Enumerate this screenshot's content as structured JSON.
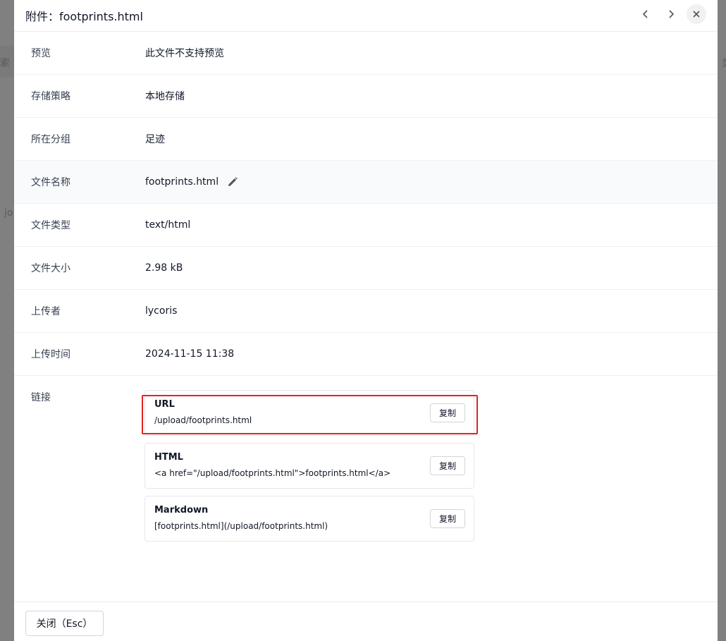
{
  "backdrop": {
    "left_glyph": "索",
    "left_glyph2": "jo",
    "right_glyph": "类"
  },
  "modal": {
    "title": "附件：footprints.html",
    "prev_label": "‹",
    "next_label": "›",
    "close_label": "✕"
  },
  "details": [
    {
      "label": "预览",
      "value": "此文件不支持预览"
    },
    {
      "label": "存储策略",
      "value": "本地存储"
    },
    {
      "label": "所在分组",
      "value": "足迹"
    },
    {
      "label": "文件名称",
      "value": "footprints.html"
    },
    {
      "label": "文件类型",
      "value": "text/html"
    },
    {
      "label": "文件大小",
      "value": "2.98 kB"
    },
    {
      "label": "上传者",
      "value": "lycoris"
    },
    {
      "label": "上传时间",
      "value": "2024-11-15 11:38"
    }
  ],
  "links": {
    "label": "链接",
    "items": [
      {
        "title": "URL",
        "value": "/upload/footprints.html",
        "copy": "复制"
      },
      {
        "title": "HTML",
        "value": "<a href=\"/upload/footprints.html\">footprints.html</a>",
        "copy": "复制"
      },
      {
        "title": "Markdown",
        "value": "[footprints.html](/upload/footprints.html)",
        "copy": "复制"
      }
    ]
  },
  "footer": {
    "close_button": "关闭（Esc）"
  }
}
